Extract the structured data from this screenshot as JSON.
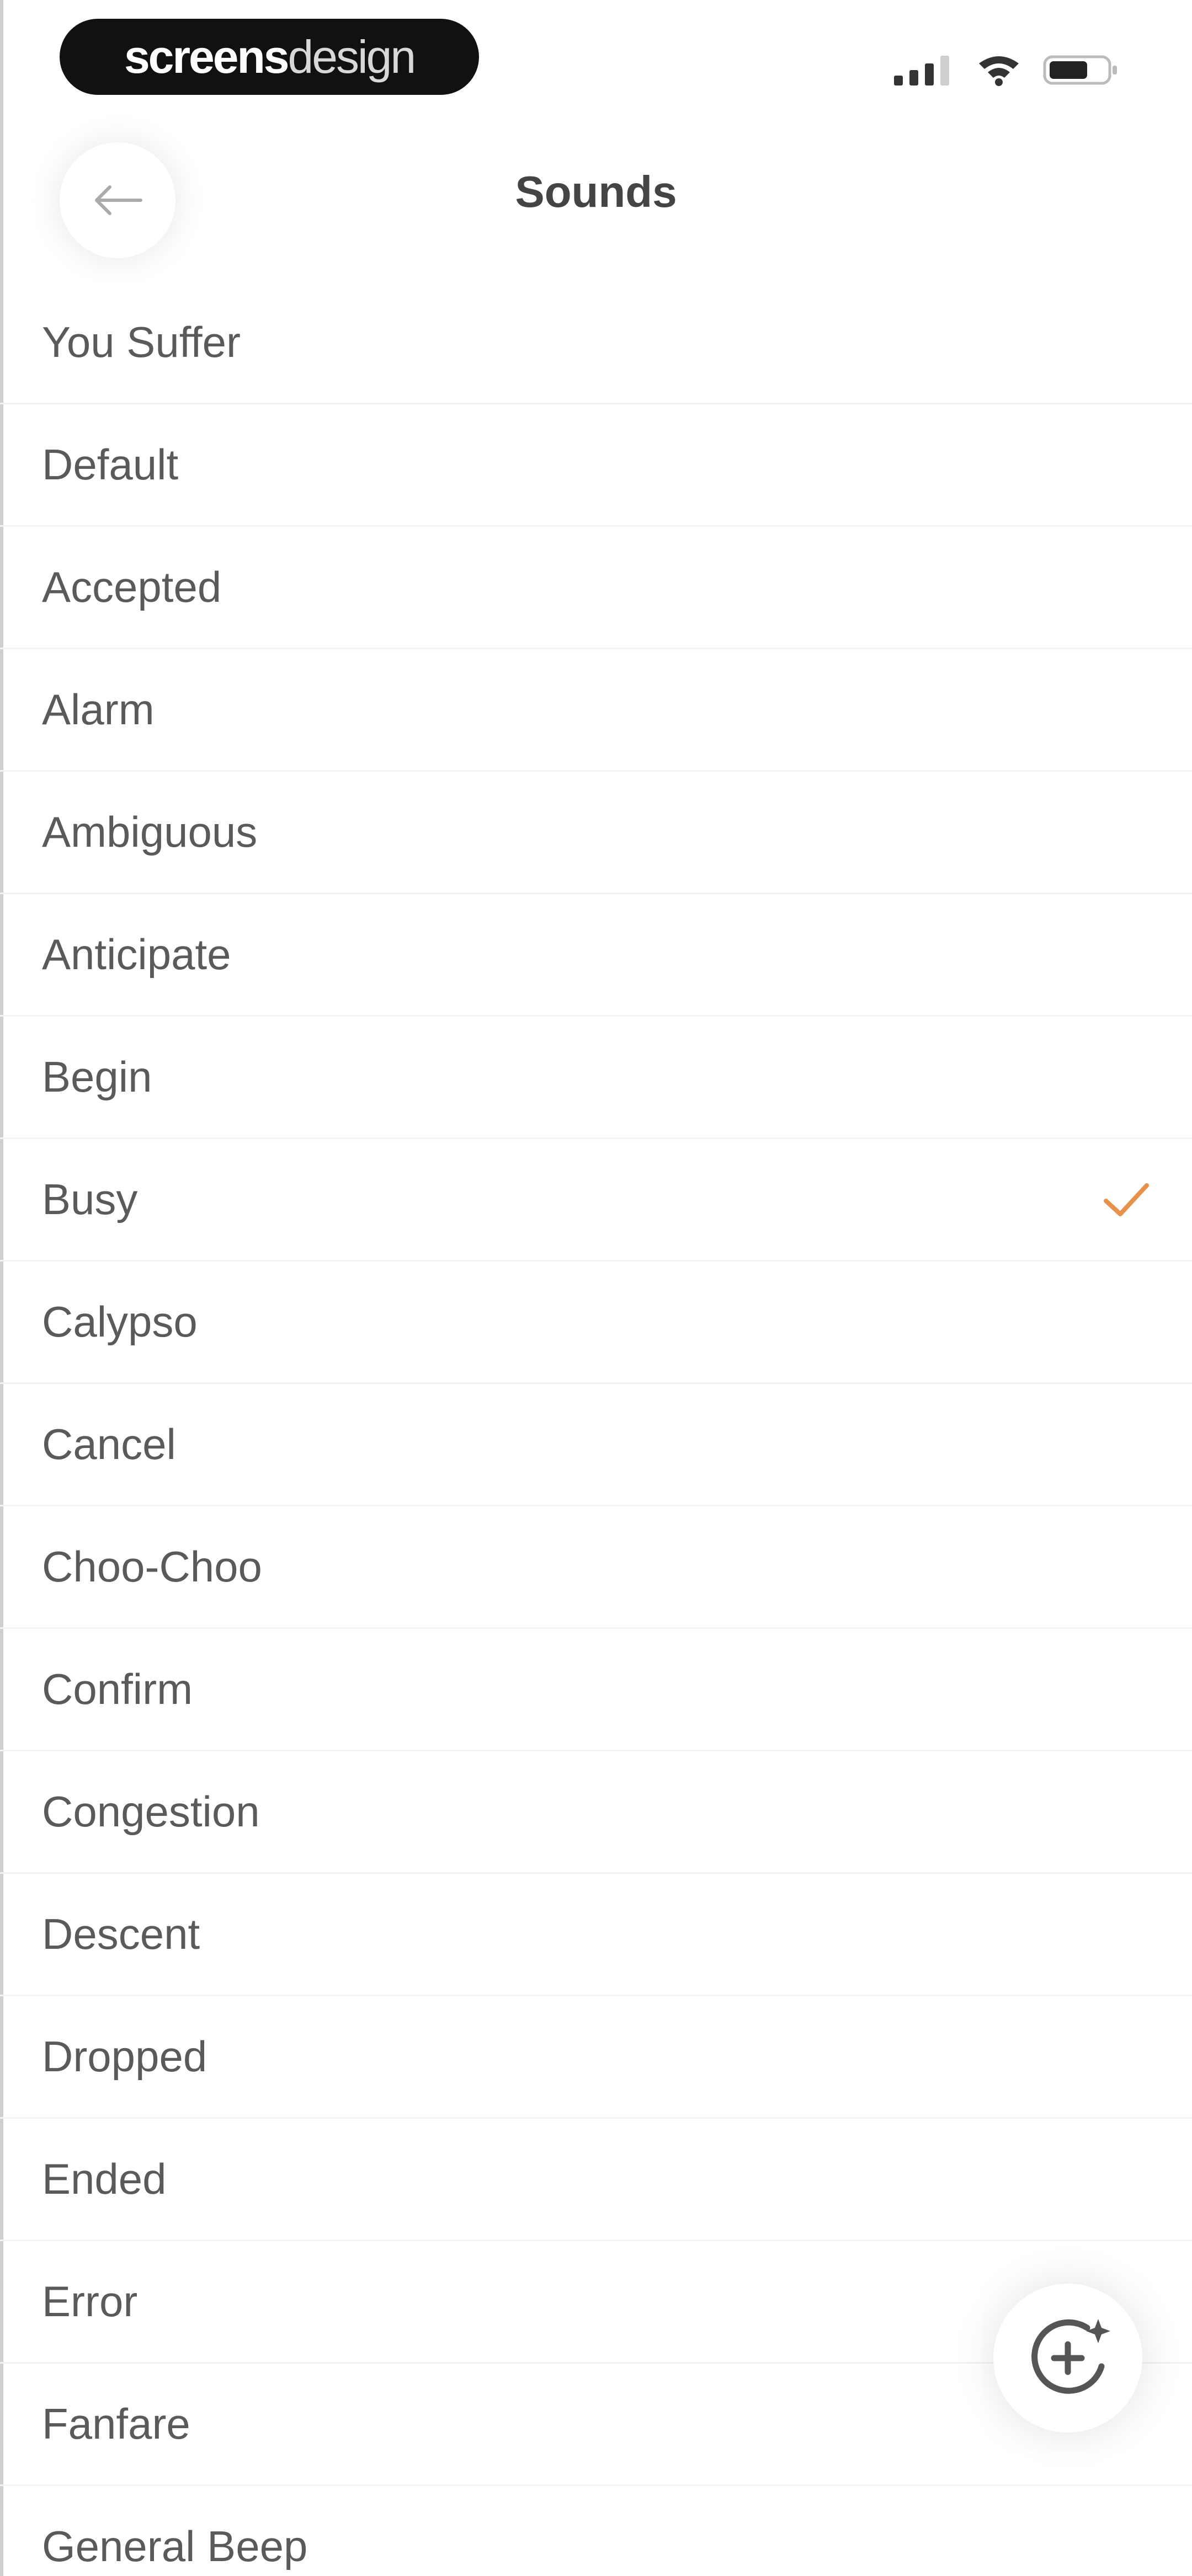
{
  "status_bar": {
    "watermark_bold": "screens",
    "watermark_light": "design",
    "icons": [
      "signal-icon",
      "wifi-icon",
      "battery-icon"
    ]
  },
  "header": {
    "title": "Sounds",
    "back_icon": "arrow-left-icon"
  },
  "sounds": {
    "selected": "Busy",
    "accent_color": "#e8914a",
    "items": [
      {
        "label": "You Suffer"
      },
      {
        "label": "Default"
      },
      {
        "label": "Accepted"
      },
      {
        "label": "Alarm"
      },
      {
        "label": "Ambiguous"
      },
      {
        "label": "Anticipate"
      },
      {
        "label": "Begin"
      },
      {
        "label": "Busy"
      },
      {
        "label": "Calypso"
      },
      {
        "label": "Cancel"
      },
      {
        "label": "Choo-Choo"
      },
      {
        "label": "Confirm"
      },
      {
        "label": "Congestion"
      },
      {
        "label": "Descent"
      },
      {
        "label": "Dropped"
      },
      {
        "label": "Ended"
      },
      {
        "label": "Error"
      },
      {
        "label": "Fanfare"
      },
      {
        "label": "General Beep"
      }
    ]
  },
  "fab": {
    "icon": "sparkle-add-icon"
  }
}
